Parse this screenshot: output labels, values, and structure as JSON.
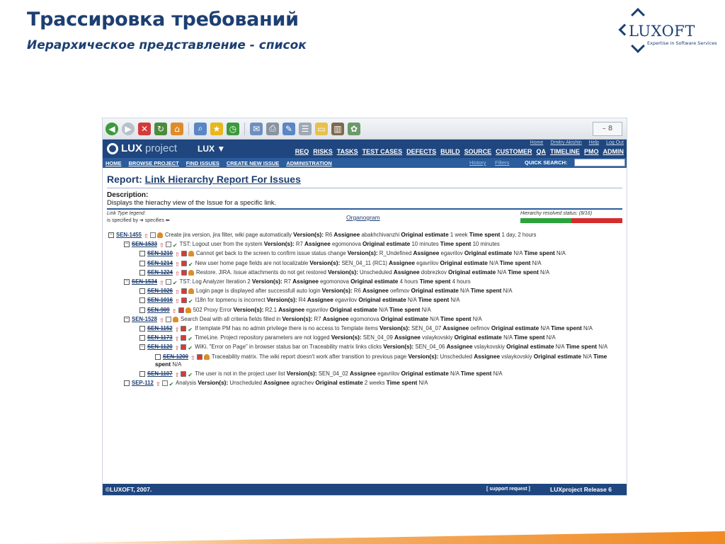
{
  "slide": {
    "title": "Трассировка требований",
    "subtitle": "Иерархическое представление - список"
  },
  "logo": {
    "brand": "LUXOFT",
    "tagline": "Expertise in Software Services"
  },
  "browser": {
    "win_controls": "– 8"
  },
  "app": {
    "logo_bold": "LUX",
    "logo_light": "project",
    "project": "LUX ▼",
    "top_links": [
      "Home",
      "Dmitry Akishin",
      "Help",
      "Log Out"
    ],
    "menu": [
      "REQ",
      "RISKS",
      "TASKS",
      "TEST CASES",
      "DEFECTS",
      "BUILD",
      "SOURCE",
      "CUSTOMER",
      "QA",
      "TIMELINE",
      "PMO",
      "ADMIN"
    ],
    "nav": [
      "HOME",
      "BROWSE PROJECT",
      "FIND ISSUES",
      "CREATE NEW ISSUE",
      "ADMINISTRATION"
    ],
    "history": "History",
    "filters": "Filters",
    "quick_search_label": "QUICK SEARCH:"
  },
  "report": {
    "title_prefix": "Report:",
    "title_link": "Link Hierarchy Report For Issues",
    "description_label": "Description:",
    "description": "Displays the hierachy view of the Issue for a specific link.",
    "legend_label": "Link Type legend:",
    "legend_text": "is specified by ➜ specifies ⬅",
    "organogram": "Organogram",
    "hierarchy_status": "Hierarchy resolved status: (8/16)"
  },
  "tree": [
    {
      "indent": 0,
      "exp": "⊟",
      "key": "SEN-1455",
      "strike": false,
      "icons": [
        "up",
        "box",
        "user"
      ],
      "summary": "Create jira version, jira filter, wiki page automatically",
      "version": "R6",
      "assignee": "abakhchivanzhi",
      "estimate": "1 week",
      "spent": "1 day, 2 hours"
    },
    {
      "indent": 1,
      "exp": "⊟",
      "key": "SEN-1533",
      "strike": true,
      "icons": [
        "up",
        "box",
        "task"
      ],
      "summary": "TST: Logout user from the system",
      "version": "R7",
      "assignee": "egomonova",
      "estimate": "10 minutes",
      "spent": "10 minutes"
    },
    {
      "indent": 2,
      "exp": "☐",
      "key": "SEN-1210",
      "strike": true,
      "icons": [
        "up",
        "bug",
        "user"
      ],
      "summary": "Cannot get back to the screen to confirm issue status change",
      "version": "R_Undefined",
      "assignee": "egavrilov",
      "estimate": "N/A",
      "spent": "N/A"
    },
    {
      "indent": 2,
      "exp": "☐",
      "key": "SEN-1214",
      "strike": true,
      "icons": [
        "up",
        "bug",
        "task"
      ],
      "summary": "New user home page fields are not localizable",
      "version": "SEN_04_11 (RC1)",
      "assignee": "egavrilov",
      "estimate": "N/A",
      "spent": "N/A"
    },
    {
      "indent": 2,
      "exp": "☐",
      "key": "SEN-1224",
      "strike": true,
      "icons": [
        "up",
        "bug",
        "user"
      ],
      "summary": "Restore. JIRA. Issue attachments do not get restored",
      "version": "Unscheduled",
      "assignee": "dobrezkov",
      "estimate": "N/A",
      "spent": "N/A"
    },
    {
      "indent": 1,
      "exp": "⊟",
      "key": "SEN-1534",
      "strike": true,
      "icons": [
        "up",
        "box",
        "task"
      ],
      "summary": "TST: Log Analyzer Iteration 2",
      "version": "R7",
      "assignee": "egomonova",
      "estimate": "4 hours",
      "spent": "4 hours"
    },
    {
      "indent": 2,
      "exp": "☐",
      "key": "SEN-1026",
      "strike": true,
      "icons": [
        "up",
        "bug",
        "user"
      ],
      "summary": "Login page is displayed after successfull auto login",
      "version": "R6",
      "assignee": "oefimov",
      "estimate": "N/A",
      "spent": "N/A"
    },
    {
      "indent": 2,
      "exp": "☐",
      "key": "SEN-1016",
      "strike": true,
      "icons": [
        "up",
        "bug",
        "task"
      ],
      "summary": "I18n for topmenu is incorrect",
      "version": "R4",
      "assignee": "egavrilov",
      "estimate": "N/A",
      "spent": "N/A"
    },
    {
      "indent": 2,
      "exp": "☐",
      "key": "SEN-909",
      "strike": true,
      "icons": [
        "up",
        "bug",
        "user"
      ],
      "summary": "502 Proxy Error",
      "version": "R2.1",
      "assignee": "egavrilov",
      "estimate": "N/A",
      "spent": "N/A"
    },
    {
      "indent": 1,
      "exp": "⊟",
      "key": "SEN-1528",
      "strike": false,
      "icons": [
        "up",
        "box",
        "user"
      ],
      "summary": "Search Deal with all criteria fields filled in",
      "version": "R7",
      "assignee": "egomonova",
      "estimate": "N/A",
      "spent": "N/A"
    },
    {
      "indent": 2,
      "exp": "☐",
      "key": "SEN-1152",
      "strike": true,
      "icons": [
        "up",
        "bug",
        "task"
      ],
      "summary": "If template PM has no admin privilege there is no access to Template items",
      "version": "SEN_04_07",
      "assignee": "oefimov",
      "estimate": "N/A",
      "spent": "N/A"
    },
    {
      "indent": 2,
      "exp": "☐",
      "key": "SEN-1173",
      "strike": true,
      "icons": [
        "up",
        "bug",
        "task"
      ],
      "summary": "TimeLine. Project repository parameters are not logged",
      "version": "SEN_04_09",
      "assignee": "vslaykovskiy",
      "estimate": "N/A",
      "spent": "N/A"
    },
    {
      "indent": 2,
      "exp": "⊟",
      "key": "SEN-1120",
      "strike": true,
      "icons": [
        "up",
        "bug",
        "task"
      ],
      "summary": "WiKi. \"Error on Page\" in browser status bar on Traceability matrix links clicks",
      "version": "SEN_04_06",
      "assignee": "vslaykovskiy",
      "estimate": "N/A",
      "spent": "N/A"
    },
    {
      "indent": 3,
      "exp": "☐",
      "key": "SEN-1200",
      "strike": true,
      "icons": [
        "up",
        "bug",
        "user"
      ],
      "summary": "Traceability matrix. The wiki report doesn't work after transition to previous page",
      "version": "Unscheduled",
      "assignee": "vslaykovskiy",
      "estimate": "N/A",
      "spent": "N/A"
    },
    {
      "indent": 2,
      "exp": "☐",
      "key": "SEN-1107",
      "strike": true,
      "icons": [
        "up",
        "bug",
        "task"
      ],
      "summary": "The user is not in the project user list",
      "version": "SEN_04_02",
      "assignee": "egavrilov",
      "estimate": "N/A",
      "spent": "N/A"
    },
    {
      "indent": 1,
      "exp": "☐",
      "key": "SEP-112",
      "strike": false,
      "icons": [
        "up",
        "box",
        "task"
      ],
      "summary": "Analysis",
      "version": "Unscheduled",
      "assignee": "agrachev",
      "estimate": "2 weeks",
      "spent": "N/A"
    }
  ],
  "tree_labels": {
    "version": "Version(s):",
    "assignee": "Assignee",
    "estimate": "Original estimate",
    "spent": "Time spent"
  },
  "footer": {
    "copyright": "©LUXOFT, 2007.",
    "support": "[ support request ]",
    "release": "LUXproject Release 6"
  }
}
